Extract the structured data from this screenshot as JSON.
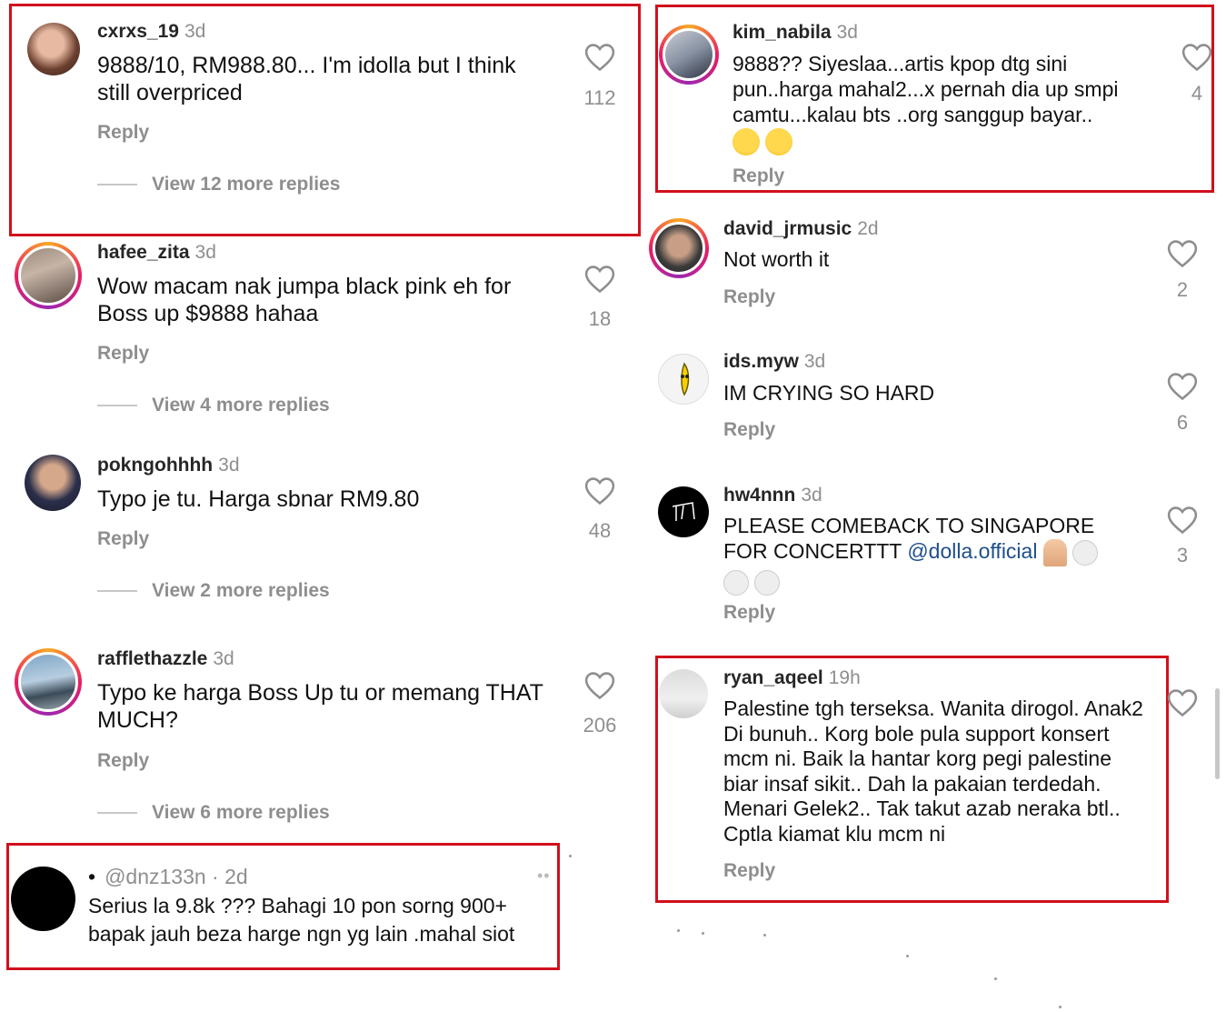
{
  "left_column": {
    "c1": {
      "user": "cxrxs_19",
      "time": "3d",
      "text": "9888/10, RM988.80... I'm idolla but I think still overpriced",
      "reply": "Reply",
      "likes": "112",
      "view_more": "View 12 more replies"
    },
    "c2": {
      "user": "hafee_zita",
      "time": "3d",
      "text": "Wow macam nak jumpa black pink eh for Boss up $9888 hahaa",
      "reply": "Reply",
      "likes": "18",
      "view_more": "View 4 more replies"
    },
    "c3": {
      "user": "pokngohhhh",
      "time": "3d",
      "text": "Typo je tu. Harga sbnar RM9.80",
      "reply": "Reply",
      "likes": "48",
      "view_more": "View 2 more replies"
    },
    "c4": {
      "user": "rafflethazzle",
      "time": "3d",
      "text": "Typo ke harga Boss Up tu or memang THAT MUCH?",
      "reply": "Reply",
      "likes": "206",
      "view_more": "View 6 more replies"
    },
    "c5": {
      "bullet": "•",
      "handle": "@dnz133n · 2d",
      "text": "Serius la 9.8k ??? Bahagi 10 pon sorng 900+ bapak jauh beza harge ngn yg lain .mahal siot",
      "more": "••"
    }
  },
  "right_column": {
    "c1": {
      "user": "kim_nabila",
      "time": "3d",
      "text": "9888?? Siyeslaa...artis kpop dtg sini pun..harga mahal2...x pernah dia up smpi camtu...kalau bts ..org sanggup bayar..",
      "reply": "Reply",
      "likes": "4"
    },
    "c2": {
      "user": "david_jrmusic",
      "time": "2d",
      "text": "Not worth it",
      "reply": "Reply",
      "likes": "2"
    },
    "c3": {
      "user": "ids.myw",
      "time": "3d",
      "text": "IM CRYING SO HARD",
      "reply": "Reply",
      "likes": "6"
    },
    "c4": {
      "user": "hw4nnn",
      "time": "3d",
      "text_before": "PLEASE COMEBACK TO SINGAPORE FOR CONCERTTT ",
      "mention": "@dolla.official",
      "reply": "Reply",
      "likes": "3"
    },
    "c5": {
      "user": "ryan_aqeel",
      "time": "19h",
      "text": "Palestine tgh terseksa. Wanita dirogol. Anak2 Di bunuh.. Korg bole pula support konsert mcm ni. Baik la hantar korg pegi palestine biar insaf sikit.. Dah la pakaian terdedah. Menari Gelek2.. Tak takut azab neraka btl.. Cptla kiamat klu mcm ni",
      "reply": "Reply"
    }
  },
  "colors": {
    "highlight_border": "#d0101c",
    "muted_text": "#8e8e8e",
    "mention": "#1f4e8c"
  },
  "icons": {
    "like": "heart-outline-icon"
  }
}
